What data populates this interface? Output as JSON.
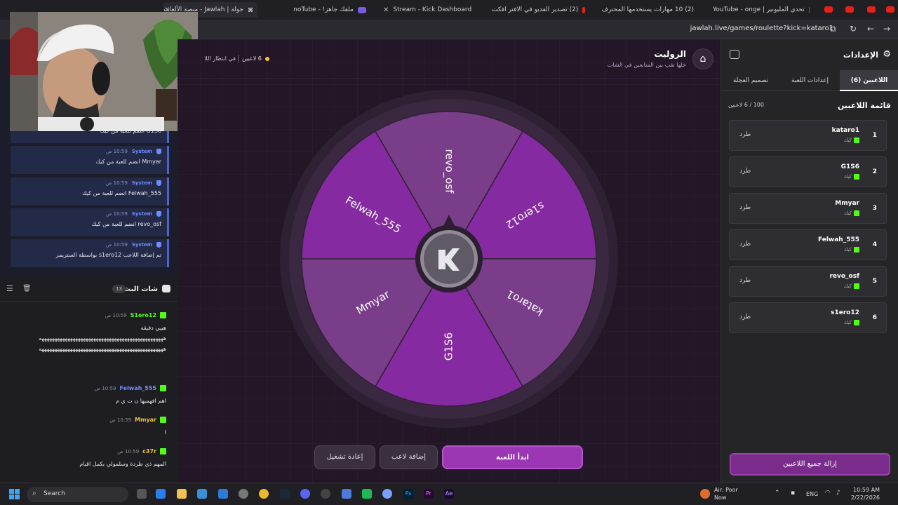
{
  "browser": {
    "tabs": [
      {
        "label": "جولة | Jawlah - منصة الألعاب التف",
        "icon": "jawlah"
      },
      {
        "label": "ملفك جاهز! - noTube",
        "icon": "notube"
      },
      {
        "label": "Stream - Kick Dashboard",
        "icon": "kick"
      },
      {
        "label": "(2) تصدير الفديو في الافتر افكت",
        "icon": "youtube"
      },
      {
        "label": "(2) 10 مهارات يستخدمها المحترف",
        "icon": "youtube"
      },
      {
        "label": "تحدي المليونير | YouTube - onge",
        "icon": "youtube"
      }
    ],
    "url": "jawlah.live/games/roulette?kick=kataro1"
  },
  "system_messages": [
    {
      "sender": "System",
      "time": "10:59 ص",
      "text": "G1S6 انضم للعبة من كيك"
    },
    {
      "sender": "System",
      "time": "10:59 ص",
      "text": "Mmyar انضم للعبة من كيك"
    },
    {
      "sender": "System",
      "time": "10:59 ص",
      "text": "Felwah_555 انضم للعبة من كيك"
    },
    {
      "sender": "System",
      "time": "10:59 ص",
      "text": "revo_osf انضم للعبة من كيك"
    },
    {
      "sender": "System",
      "time": "10:59 ص",
      "text": "تم إضافة اللاعب s1ero12 بواسطة الستريمر"
    }
  ],
  "chat": {
    "title": "شات البث",
    "count": "13",
    "messages": [
      {
        "user": "S1ero12",
        "color": "#53fc18",
        "time": "10:59 ص",
        "text": "هييي دقيقه"
      },
      {
        "user": "",
        "color": "#53fc18",
        "time": "",
        "text": "ههههههههههههههههههههههههههههههههههههههههههههههههه"
      },
      {
        "user": "",
        "color": "#53fc18",
        "time": "",
        "text": "ههههههههههههههههههههههههههههههههههههههههههههههههه"
      },
      {
        "user": "Felwah_555",
        "color": "#6f8cff",
        "time": "10:59 ص",
        "text": "اهم افهميها ن ت ي م"
      },
      {
        "user": "Mmyar",
        "color": "#f0c040",
        "time": "10:59 ص",
        "text": "ا"
      },
      {
        "user": "c37r",
        "color": "#f0c040",
        "time": "10:59 ص",
        "text": "المهم ذي طردة وسلمولي بكمل اقيام"
      }
    ]
  },
  "game": {
    "title": "الروليت",
    "subtitle": "خلها تقب بين المتابعين في الشات",
    "player_count_label": "6 لاعبين",
    "waiting_label": "في انتظار اللاعبين",
    "wheel_segments": [
      "revo_osf",
      "s1ero12",
      "kataro1",
      "G1S6",
      "Mmyar",
      "Felwah_555"
    ],
    "segment_colors": [
      "#7a3d8a",
      "#852aa0"
    ],
    "start_label": "ابدأ اللعبة",
    "add_player_label": "إضافة لاعب",
    "restart_label": "إعادة تشغيل"
  },
  "settings": {
    "title": "الإعدادات",
    "tabs": [
      {
        "label": "اللاعبين (6)",
        "active": true
      },
      {
        "label": "إعدادات اللعبة",
        "active": false
      },
      {
        "label": "تصميم العجلة",
        "active": false
      }
    ],
    "list_title": "قائمة اللاعبين",
    "list_count": "100 / 6 لاعبين",
    "players": [
      {
        "index": "1",
        "name": "kataro1",
        "platform": "كيك",
        "kick_label": "طرد"
      },
      {
        "index": "2",
        "name": "G1S6",
        "platform": "كيك",
        "kick_label": "طرد"
      },
      {
        "index": "3",
        "name": "Mmyar",
        "platform": "كيك",
        "kick_label": "طرد"
      },
      {
        "index": "4",
        "name": "Felwah_555",
        "platform": "كيك",
        "kick_label": "طرد"
      },
      {
        "index": "5",
        "name": "revo_osf",
        "platform": "كيك",
        "kick_label": "طرد"
      },
      {
        "index": "6",
        "name": "s1ero12",
        "platform": "كيك",
        "kick_label": "طرد"
      }
    ],
    "remove_all_label": "إزالة جميع اللاعبين"
  },
  "taskbar": {
    "search": "Search",
    "weather_title": "Air: Poor",
    "weather_sub": "Now",
    "lang": "ENG",
    "time": "10:59 AM",
    "date": "2/22/2026"
  }
}
